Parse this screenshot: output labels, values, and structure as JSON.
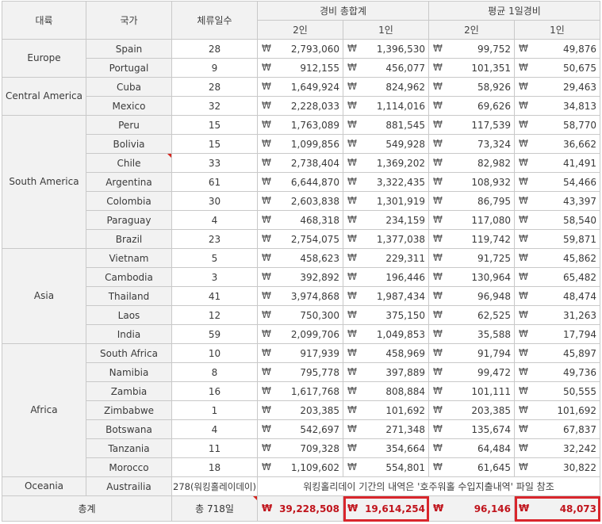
{
  "header": {
    "continent": "대륙",
    "country": "국가",
    "days": "체류일수",
    "total_group": "경비 총합계",
    "avg_group": "평균 1일경비",
    "two_person": "2인",
    "one_person": "1인"
  },
  "currency_symbol": "₩",
  "groups": [
    {
      "continent": "Europe",
      "rows": [
        {
          "country": "Spain",
          "days": "28",
          "total2": "2,793,060",
          "total1": "1,396,530",
          "avg2": "99,752",
          "avg1": "49,876"
        },
        {
          "country": "Portugal",
          "days": "9",
          "total2": "912,155",
          "total1": "456,077",
          "avg2": "101,351",
          "avg1": "50,675"
        }
      ]
    },
    {
      "continent": "Central America",
      "rows": [
        {
          "country": "Cuba",
          "days": "28",
          "total2": "1,649,924",
          "total1": "824,962",
          "avg2": "58,926",
          "avg1": "29,463"
        },
        {
          "country": "Mexico",
          "days": "32",
          "total2": "2,228,033",
          "total1": "1,114,016",
          "avg2": "69,626",
          "avg1": "34,813"
        }
      ]
    },
    {
      "continent": "South America",
      "rows": [
        {
          "country": "Peru",
          "days": "15",
          "total2": "1,763,089",
          "total1": "881,545",
          "avg2": "117,539",
          "avg1": "58,770"
        },
        {
          "country": "Bolivia",
          "days": "15",
          "total2": "1,099,856",
          "total1": "549,928",
          "avg2": "73,324",
          "avg1": "36,662"
        },
        {
          "country": "Chile",
          "days": "33",
          "total2": "2,738,404",
          "total1": "1,369,202",
          "avg2": "82,982",
          "avg1": "41,491"
        },
        {
          "country": "Argentina",
          "days": "61",
          "total2": "6,644,870",
          "total1": "3,322,435",
          "avg2": "108,932",
          "avg1": "54,466"
        },
        {
          "country": "Colombia",
          "days": "30",
          "total2": "2,603,838",
          "total1": "1,301,919",
          "avg2": "86,795",
          "avg1": "43,397"
        },
        {
          "country": "Paraguay",
          "days": "4",
          "total2": "468,318",
          "total1": "234,159",
          "avg2": "117,080",
          "avg1": "58,540"
        },
        {
          "country": "Brazil",
          "days": "23",
          "total2": "2,754,075",
          "total1": "1,377,038",
          "avg2": "119,742",
          "avg1": "59,871"
        }
      ]
    },
    {
      "continent": "Asia",
      "rows": [
        {
          "country": "Vietnam",
          "days": "5",
          "total2": "458,623",
          "total1": "229,311",
          "avg2": "91,725",
          "avg1": "45,862"
        },
        {
          "country": "Cambodia",
          "days": "3",
          "total2": "392,892",
          "total1": "196,446",
          "avg2": "130,964",
          "avg1": "65,482"
        },
        {
          "country": "Thailand",
          "days": "41",
          "total2": "3,974,868",
          "total1": "1,987,434",
          "avg2": "96,948",
          "avg1": "48,474"
        },
        {
          "country": "Laos",
          "days": "12",
          "total2": "750,300",
          "total1": "375,150",
          "avg2": "62,525",
          "avg1": "31,263"
        },
        {
          "country": "India",
          "days": "59",
          "total2": "2,099,706",
          "total1": "1,049,853",
          "avg2": "35,588",
          "avg1": "17,794"
        }
      ]
    },
    {
      "continent": "Africa",
      "rows": [
        {
          "country": "South Africa",
          "days": "10",
          "total2": "917,939",
          "total1": "458,969",
          "avg2": "91,794",
          "avg1": "45,897"
        },
        {
          "country": "Namibia",
          "days": "8",
          "total2": "795,778",
          "total1": "397,889",
          "avg2": "99,472",
          "avg1": "49,736"
        },
        {
          "country": "Zambia",
          "days": "16",
          "total2": "1,617,768",
          "total1": "808,884",
          "avg2": "101,111",
          "avg1": "50,555"
        },
        {
          "country": "Zimbabwe",
          "days": "1",
          "total2": "203,385",
          "total1": "101,692",
          "avg2": "203,385",
          "avg1": "101,692"
        },
        {
          "country": "Botswana",
          "days": "4",
          "total2": "542,697",
          "total1": "271,348",
          "avg2": "135,674",
          "avg1": "67,837"
        },
        {
          "country": "Tanzania",
          "days": "11",
          "total2": "709,328",
          "total1": "354,664",
          "avg2": "64,484",
          "avg1": "32,242"
        },
        {
          "country": "Morocco",
          "days": "18",
          "total2": "1,109,602",
          "total1": "554,801",
          "avg2": "61,645",
          "avg1": "30,822"
        }
      ]
    }
  ],
  "oceania": {
    "continent": "Oceania",
    "country": "Austrailia",
    "days": "278(워킹홀레이데이)",
    "note": "워킹홀리데이 기간의 내역은 '호주워홀 수입지출내역' 파일 참조"
  },
  "total": {
    "label": "총계",
    "days": "총 718일",
    "total2": "39,228,508",
    "total1": "19,614,254",
    "avg2": "96,146",
    "avg1": "48,073"
  }
}
